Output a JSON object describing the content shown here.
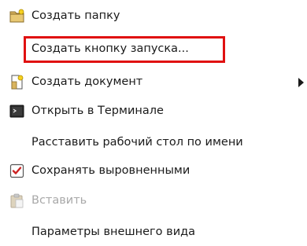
{
  "context_menu": {
    "items": [
      {
        "label": "Создать папку",
        "icon": "folder-new-icon"
      },
      {
        "label": "Создать кнопку запуска..."
      },
      {
        "label": "Создать документ",
        "icon": "document-new-icon",
        "has_submenu": true
      },
      {
        "label": "Открыть в Терминале",
        "icon": "terminal-icon"
      },
      {
        "label": "Расставить рабочий стол по имени"
      },
      {
        "label": "Сохранять выровненными",
        "icon": "checkbox-checked-icon",
        "checked": true
      },
      {
        "label": "Вставить",
        "icon": "clipboard-paste-icon",
        "disabled": true
      },
      {
        "label": "Параметры внешнего вида"
      }
    ],
    "highlighted_item": "Создать кнопку запуска...",
    "colors": {
      "highlight_border": "#e01010",
      "folder": "#d9b45f",
      "check": "#cc2222",
      "text": "#1a1a1a",
      "disabled_text": "#a8a8a8"
    }
  }
}
